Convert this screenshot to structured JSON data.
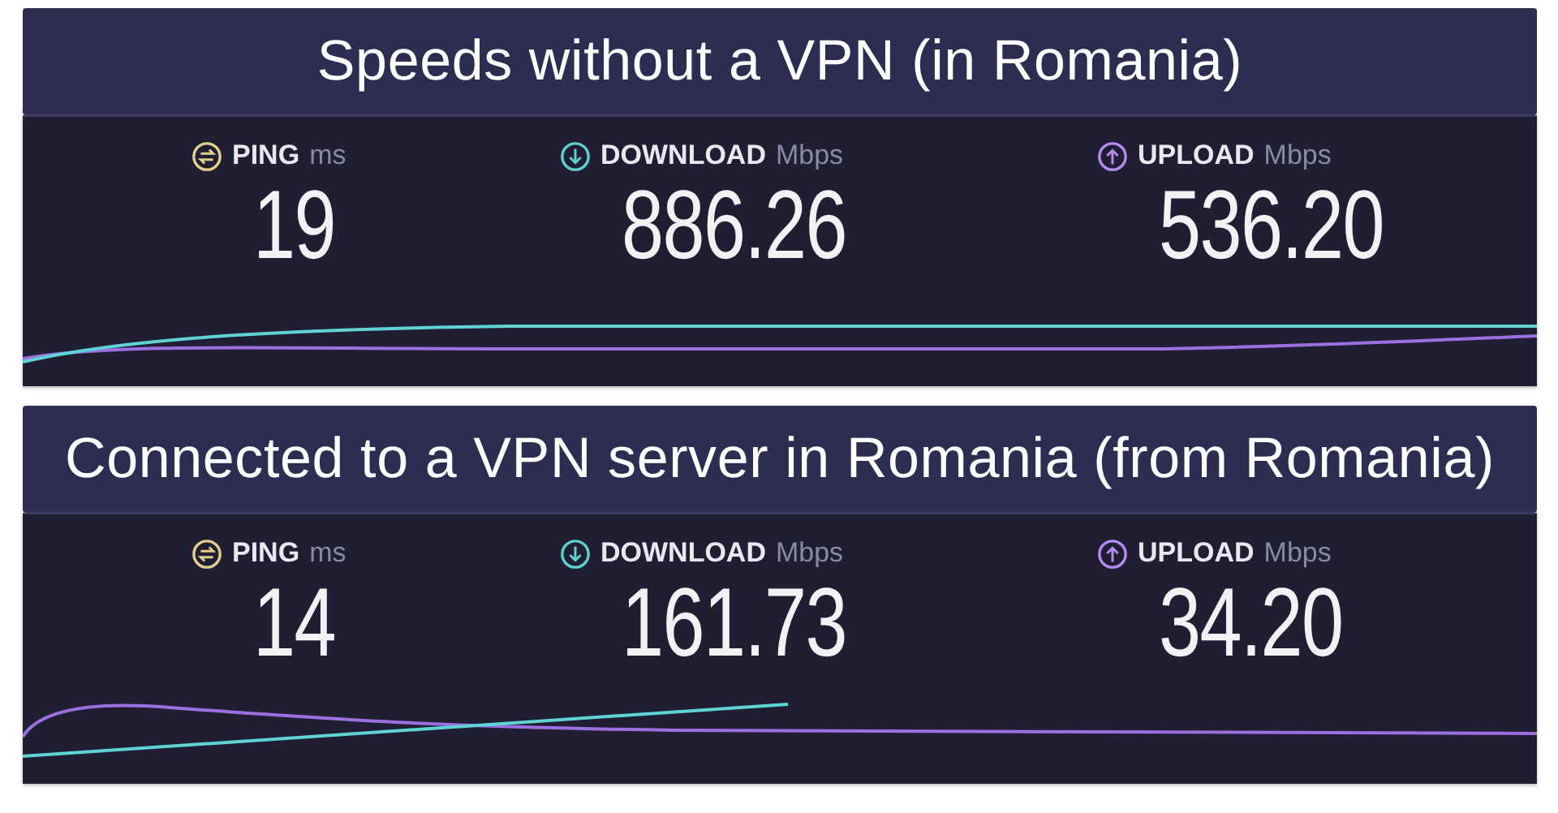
{
  "sections": [
    {
      "title": "Speeds without a VPN (in Romania)",
      "metrics": [
        {
          "kind": "ping",
          "label": "PING",
          "unit": "ms",
          "value": "19"
        },
        {
          "kind": "download",
          "label": "DOWNLOAD",
          "unit": "Mbps",
          "value": "886.26"
        },
        {
          "kind": "upload",
          "label": "UPLOAD",
          "unit": "Mbps",
          "value": "536.20"
        }
      ]
    },
    {
      "title": "Connected to a VPN server in Romania (from Romania)",
      "metrics": [
        {
          "kind": "ping",
          "label": "PING",
          "unit": "ms",
          "value": "14"
        },
        {
          "kind": "download",
          "label": "DOWNLOAD",
          "unit": "Mbps",
          "value": "161.73"
        },
        {
          "kind": "upload",
          "label": "UPLOAD",
          "unit": "Mbps",
          "value": "34.20"
        }
      ]
    }
  ]
}
